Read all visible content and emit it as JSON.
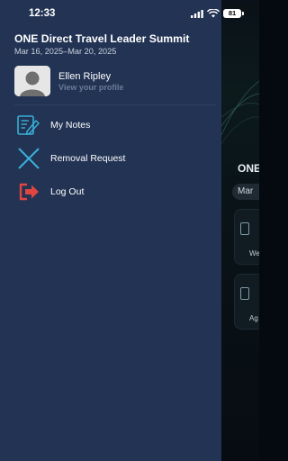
{
  "status_bar": {
    "time": "12:33",
    "battery": "81"
  },
  "drawer": {
    "event_title": "ONE Direct Travel Leader Summit",
    "event_dates": "Mar 16, 2025–Mar 20, 2025",
    "profile": {
      "name": "Ellen Ripley",
      "link": "View your profile"
    },
    "menu": [
      {
        "label": "My Notes",
        "icon": "notes-icon"
      },
      {
        "label": "Removal Request",
        "icon": "close-x-icon"
      },
      {
        "label": "Log Out",
        "icon": "logout-icon"
      }
    ]
  },
  "background": {
    "title": "ONE",
    "chip": "Mar",
    "card_1_label": "We",
    "card_2_label": "Ag"
  },
  "colors": {
    "drawer_bg": "#223354",
    "accent_cyan": "#3ab0d8",
    "logout_red": "#e0463f"
  }
}
